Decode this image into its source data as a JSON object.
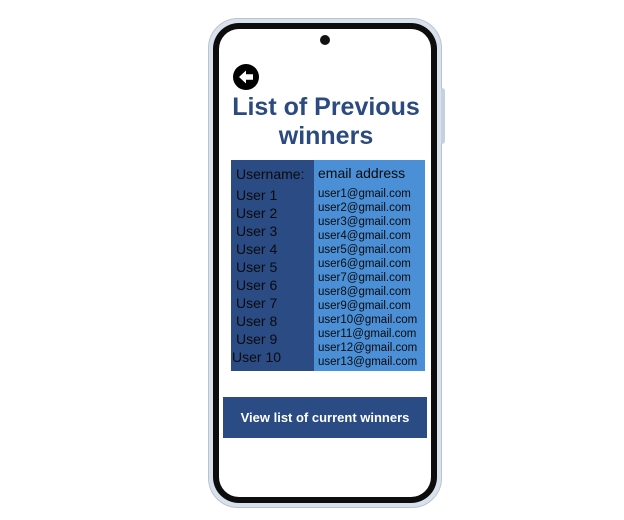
{
  "screen": {
    "title": "List of Previous winners"
  },
  "back": {
    "icon": "arrow-left-icon"
  },
  "table": {
    "headers": {
      "username": "Username:",
      "email": "email address"
    },
    "users": [
      "User 1",
      "User 2",
      "User 3",
      "User 4",
      "User 5",
      "User 6",
      "User 7",
      "User 8",
      "User 9",
      "User 10"
    ],
    "emails": [
      "user1@gmail.com",
      "user2@gmail.com",
      "user3@gmail.com",
      "user4@gmail.com",
      "user5@gmail.com",
      "user6@gmail.com",
      "user7@gmail.com",
      "user8@gmail.com",
      "user9@gmail.com",
      "user10@gmail.com",
      "user11@gmail.com",
      "user12@gmail.com",
      "user13@gmail.com"
    ]
  },
  "actions": {
    "view_current_label": "View list of current winners"
  },
  "colors": {
    "brand_dark": "#2a4b84",
    "brand_light": "#4b8fd6",
    "title": "#2b4a7f"
  }
}
